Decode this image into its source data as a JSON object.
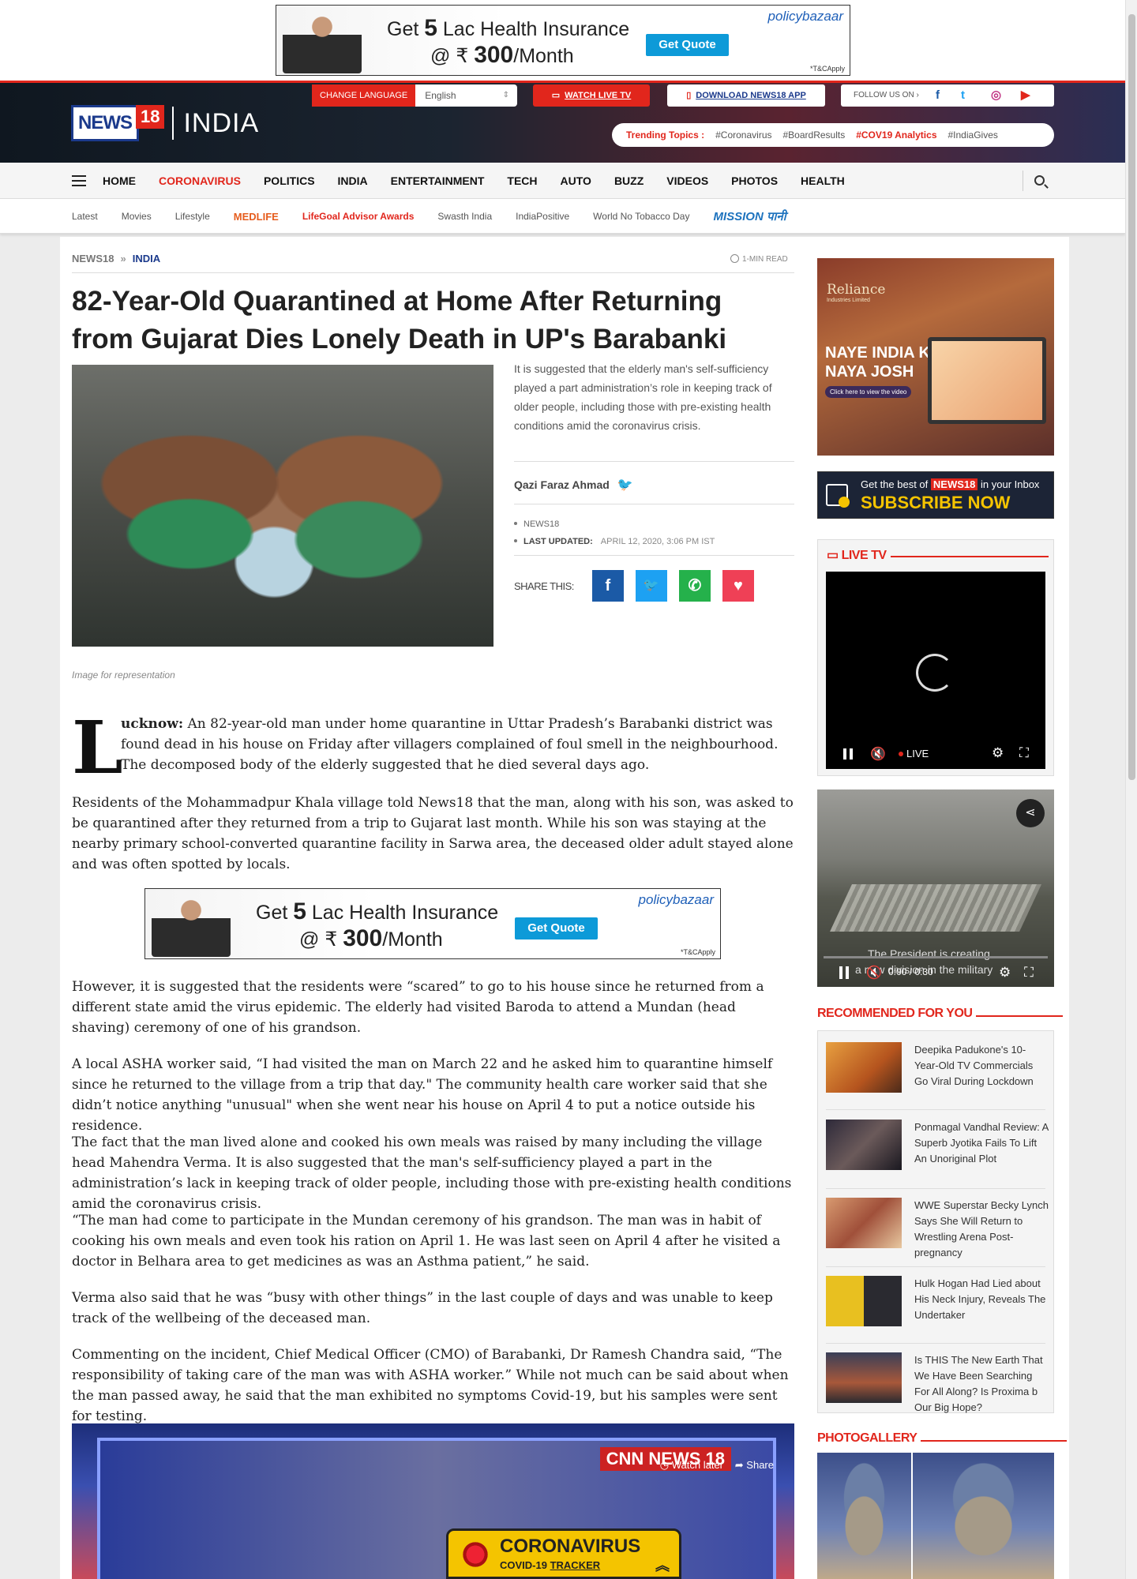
{
  "ads": {
    "top_line1_pre": "Get",
    "top_line1_num": "5",
    "top_line1_post": "Lac Health Insurance",
    "top_line2_pre": "@ ₹",
    "top_line2_num": "300",
    "top_line2_post": "/Month",
    "brand": "policybazaar",
    "cta": "Get Quote",
    "tc": "*T&CApply"
  },
  "header": {
    "logo_word": "NEWS",
    "logo_num": "18",
    "section": "INDIA",
    "change_language": "CHANGE LANGUAGE",
    "language_value": "English",
    "watch_live": "WATCH LIVE TV",
    "download_app": "DOWNLOAD NEWS18 APP",
    "follow_us": "FOLLOW US ON",
    "trending_label": "Trending Topics :",
    "trending": [
      "#Coronavirus",
      "#BoardResults",
      "#COV19 Analytics",
      "#IndiaGives"
    ]
  },
  "nav": {
    "items": [
      "HOME",
      "CORONAVIRUS",
      "POLITICS",
      "INDIA",
      "ENTERTAINMENT",
      "TECH",
      "AUTO",
      "BUZZ",
      "VIDEOS",
      "PHOTOS",
      "HEALTH"
    ],
    "active_index": 1
  },
  "subnav": {
    "items": [
      "Latest",
      "Movies",
      "Lifestyle",
      "MEDLIFE",
      "LifeGoal Advisor Awards",
      "Swasth India",
      "IndiaPositive",
      "World No Tobacco Day",
      "MISSION पानी"
    ]
  },
  "article": {
    "breadcrumb": [
      "NEWS18",
      "INDIA"
    ],
    "read_time": "1-MIN READ",
    "headline": "82-Year-Old Quarantined at Home After Returning from Gujarat Dies Lonely Death in UP's Barabanki",
    "summary": "It is suggested that the elderly man's self-sufficiency played a part administration’s role in keeping track of older people, including those with pre-existing health conditions amid the coronavirus crisis.",
    "author": "Qazi Faraz Ahmad",
    "source": "NEWS18",
    "last_updated_label": "LAST UPDATED:",
    "last_updated": "APRIL 12, 2020, 3:06 PM IST",
    "share_label": "SHARE THIS:",
    "image_caption": "Image for representation",
    "dropcap": "L",
    "lead_word": "ucknow:",
    "p1": "An 82-year-old man under home quarantine in Uttar Pradesh’s Barabanki district was found dead in his house on Friday after villagers complained of foul smell in the neighbourhood. The decomposed body of the elderly suggested that he died several days ago.",
    "p2": "Residents of the Mohammadpur Khala village told News18 that the man, along with his son, was asked to be quarantined after they returned from a trip to Gujarat last month. While his son was staying at the nearby primary school-converted quarantine facility in Sarwa area, the deceased older adult stayed alone and was often spotted by locals.",
    "p3": "However, it is suggested that the residents were “scared” to go to his house since he returned from a different state amid the virus epidemic. The elderly had visited Baroda to attend a Mundan (head shaving) ceremony of one of his grandson.",
    "p4": "A local ASHA worker said, “I had visited the man on March 22 and he asked him to quarantine himself since he returned to the village from a trip that day.\" The community health care worker said that she didn’t notice anything \"unusual\" when she went near his house on April 4 to put a notice outside his residence.",
    "p5": "The fact that the man lived alone and cooked his own meals was raised by many including the village head Mahendra Verma. It is also suggested that the man's self-sufficiency played a part in the administration’s lack in keeping track of older people, including those with pre-existing health conditions amid the coronavirus crisis.",
    "p6": "“The man had come to participate in the Mundan ceremony of his grandson. The man was in habit of cooking his own meals and even took his ration on April 1. He was last seen on April 4 after he visited a doctor in Belhara area to get medicines as was an Asthma patient,” he said.",
    "p7": "Verma also said that he was “busy with other things” in the last couple of days and was unable to keep track of the wellbeing of the deceased man.",
    "p8": "Commenting on the incident, Chief Medical Officer (CMO) of Barabanki, Dr Ramesh Chandra said, “The responsibility of taking care of the man was with ASHA worker.” While not much can be said about when the man passed away, he said that the man exhibited no symptoms Covid-19, but his samples were sent for testing."
  },
  "embed": {
    "watch_later": "Watch later",
    "share": "Share",
    "channel_logo": "CNN NEWS 18"
  },
  "covid_tracker": {
    "title": "CORONAVIRUS",
    "sub_pre": "COVID-19",
    "sub_link": "TRACKER"
  },
  "sidebar": {
    "ad1_brand": "Reliance",
    "ad1_brand_sub": "Industries Limited",
    "ad1_line1": "NAYE INDIA KA",
    "ad1_line2": "NAYA JOSH",
    "ad1_cta": "Click here to view the video",
    "ad2_pre": "Get the best of",
    "ad2_brand": "NEWS18",
    "ad2_post": "in your Inbox",
    "ad2_cta": "SUBSCRIBE NOW",
    "live_tv_title": "LIVE TV",
    "live_label": "LIVE",
    "video2_caption1": "The President is creating",
    "video2_caption2": "a new division in the military",
    "video2_time": "0:00 / 0:30",
    "recommended_title": "RECOMMENDED FOR YOU",
    "recommended": [
      "Deepika Padukone's 10-Year-Old TV Commercials Go Viral During Lockdown",
      "Ponmagal Vandhal Review: A Superb Jyotika Fails To Lift An Unoriginal Plot",
      "WWE Superstar Becky Lynch Says She Will Return to Wrestling Arena Post-pregnancy",
      "Hulk Hogan Had Lied about His Neck Injury, Reveals The Undertaker",
      "Is THIS The New Earth That We Have Been Searching For All Along? Is Proxima b Our Big Hope?"
    ],
    "photogallery_title": "PHOTOGALLERY"
  },
  "colors": {
    "brand_red": "#e1261c",
    "brand_blue": "#1b3a8c",
    "facebook": "#1b5aa6",
    "twitter": "#1da1f2",
    "whatsapp": "#25b14b",
    "pocket": "#ef4056"
  }
}
